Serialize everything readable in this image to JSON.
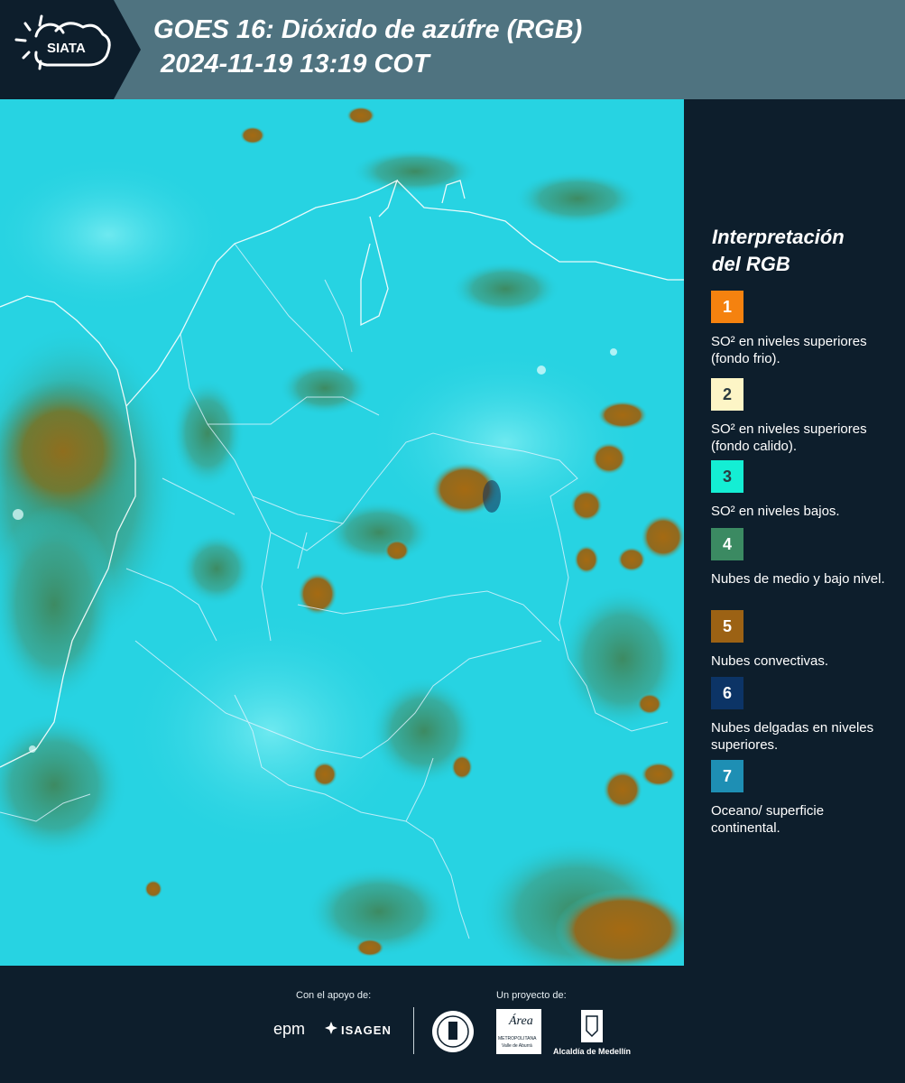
{
  "header": {
    "logo_text": "SIATA",
    "title_line1": "GOES 16: Dióxido de azúfre (RGB)",
    "title_line2": "2024-11-19 13:19 COT"
  },
  "legend": {
    "title_line1": "Interpretación",
    "title_line2": "del RGB",
    "items": [
      {
        "number": "1",
        "label": "SO² en niveles superiores (fondo frio).",
        "color": "#f5820f"
      },
      {
        "number": "2",
        "label": "SO² en niveles superiores (fondo calido).",
        "color": "#fdf5c6"
      },
      {
        "number": "3",
        "label": "SO² en niveles bajos.",
        "color": "#14eed4"
      },
      {
        "number": "4",
        "label": "Nubes de medio y bajo nivel.",
        "color": "#3b8a62"
      },
      {
        "number": "5",
        "label": "Nubes convectivas.",
        "color": "#9c6214"
      },
      {
        "number": "6",
        "label": "Nubes delgadas en niveles superiores.",
        "color": "#0c3466"
      },
      {
        "number": "7",
        "label": "Oceano/ superficie continental.",
        "color": "#1e8fb4"
      }
    ]
  },
  "footer": {
    "support_label": "Con el apoyo de:",
    "project_label": "Un proyecto de:",
    "sponsor_1": "epm",
    "sponsor_2": "ISAGEN",
    "partner_1": "Área",
    "partner_1_sub": "METROPOLITANA",
    "partner_1_sub2": "Valle de Aburrá",
    "partner_2": "Alcaldía de Medellín"
  },
  "colors": {
    "header_bg": "#4f7380",
    "page_bg": "#0d1e2c",
    "map_base": "#22d0e0",
    "cloud_green": "#3b8a62",
    "cloud_brown": "#9c6214"
  }
}
